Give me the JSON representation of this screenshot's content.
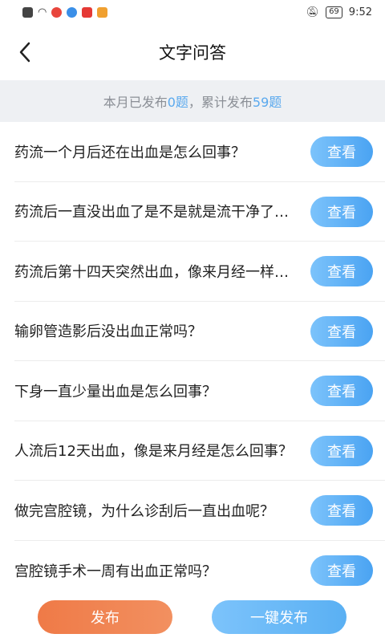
{
  "status_bar": {
    "time": "9:52",
    "battery": "69",
    "icons": [
      "alert-icon",
      "wifi-icon",
      "weibo-icon",
      "browser-icon",
      "app-red-icon",
      "app-store-icon"
    ],
    "right_icons": [
      "mute-bell-icon",
      "battery-icon"
    ]
  },
  "header": {
    "title": "文字问答",
    "back_icon": "chevron-left-icon"
  },
  "summary": {
    "prefix": "本月已发布",
    "month_count": "0题",
    "middle": "，累计发布",
    "total_count": "59题"
  },
  "questions": [
    {
      "text": "药流一个月后还在出血是怎么回事？",
      "button": "查看"
    },
    {
      "text": "药流后一直没出血了是不是就是流干净了呢？",
      "button": "查看"
    },
    {
      "text": "药流后第十四天突然出血，像来月经一样怎么回事？",
      "button": "查看"
    },
    {
      "text": "输卵管造影后没出血正常吗？",
      "button": "查看"
    },
    {
      "text": "下身一直少量出血是怎么回事？",
      "button": "查看"
    },
    {
      "text": "人流后12天出血，像是来月经是怎么回事？",
      "button": "查看"
    },
    {
      "text": "做完宫腔镜，为什么诊刮后一直出血呢？",
      "button": "查看"
    },
    {
      "text": "宫腔镜手术一周有出血正常吗？",
      "button": "查看"
    }
  ],
  "bottom": {
    "publish_label": "发布",
    "quick_publish_label": "一键发布"
  },
  "colors": {
    "accent_blue": "#5aa9ee",
    "publish_orange": "#ef7a47",
    "summary_bg": "#eef0f3"
  }
}
